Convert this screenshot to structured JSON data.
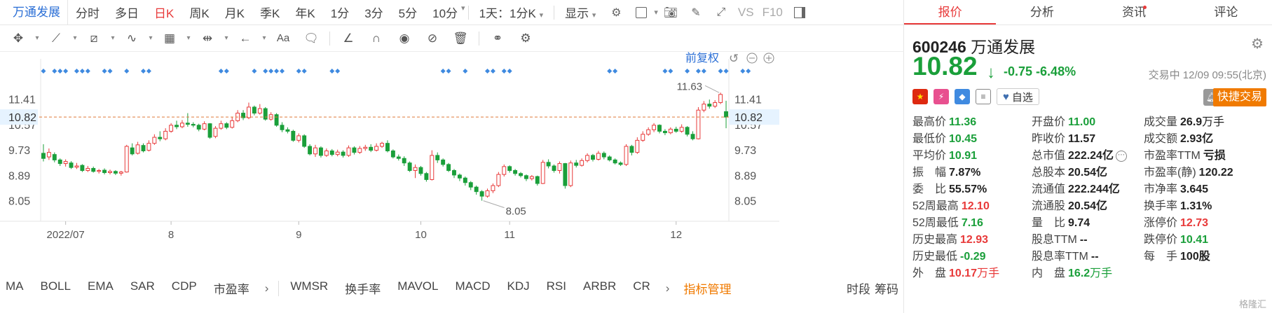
{
  "toolbar": {
    "stock_name": "万通发展",
    "periods": [
      "分时",
      "多日",
      "日K",
      "周K",
      "月K",
      "季K",
      "年K",
      "1分",
      "3分",
      "5分",
      "10分"
    ],
    "active_period": "日K",
    "range_select": "1天：1分K",
    "display_label": "显示",
    "vs_label": "VS",
    "f10_label": "F10"
  },
  "chart": {
    "adjust_label": "前复权",
    "high_marker": "11.63",
    "low_marker": "8.05",
    "current_price_tag": "10.82",
    "colors": {
      "up": "#e83a3a",
      "down": "#1a9f3a",
      "signal": "#3f8ae0",
      "price_line": "#e07b3a"
    }
  },
  "chart_data": {
    "type": "candlestick",
    "y_ticks": [
      "11.41",
      "10.57",
      "9.73",
      "8.89",
      "8.05"
    ],
    "x_ticks": [
      "2022/07",
      "8",
      "9",
      "10",
      "11",
      "12"
    ],
    "ylim": [
      7.6,
      12.1
    ],
    "current_price": 10.82,
    "candles": [
      [
        9.62,
        9.45,
        9.92,
        9.35
      ],
      [
        9.5,
        9.65,
        9.78,
        9.4
      ],
      [
        9.58,
        9.4,
        9.65,
        9.32
      ],
      [
        9.4,
        9.28,
        9.45,
        9.2
      ],
      [
        9.28,
        9.35,
        9.42,
        9.18
      ],
      [
        9.3,
        9.15,
        9.36,
        9.1
      ],
      [
        9.16,
        9.2,
        9.3,
        9.1
      ],
      [
        9.22,
        9.05,
        9.26,
        9.0
      ],
      [
        9.05,
        9.12,
        9.2,
        9.0
      ],
      [
        9.12,
        9.02,
        9.18,
        8.98
      ],
      [
        9.02,
        9.05,
        9.1,
        8.95
      ],
      [
        9.06,
        8.98,
        9.12,
        8.92
      ],
      [
        8.98,
        9.02,
        9.08,
        8.92
      ],
      [
        9.02,
        8.96,
        9.06,
        8.9
      ],
      [
        8.96,
        9.0,
        9.04,
        8.88
      ],
      [
        9.0,
        9.85,
        9.9,
        8.98
      ],
      [
        9.8,
        9.6,
        9.95,
        9.55
      ],
      [
        9.62,
        9.9,
        10.0,
        9.58
      ],
      [
        9.88,
        9.7,
        9.95,
        9.65
      ],
      [
        9.72,
        9.95,
        10.05,
        9.68
      ],
      [
        9.95,
        10.15,
        10.25,
        9.9
      ],
      [
        10.15,
        10.1,
        10.35,
        10.02
      ],
      [
        10.1,
        10.35,
        10.45,
        10.05
      ],
      [
        10.35,
        10.55,
        10.62,
        10.3
      ],
      [
        10.55,
        10.5,
        10.7,
        10.42
      ],
      [
        10.5,
        10.62,
        10.72,
        10.45
      ],
      [
        10.62,
        10.58,
        10.95,
        10.5
      ],
      [
        10.58,
        10.55,
        10.65,
        10.48
      ],
      [
        10.55,
        10.42,
        10.6,
        10.35
      ],
      [
        10.42,
        10.6,
        10.68,
        10.38
      ],
      [
        10.6,
        10.15,
        10.62,
        10.1
      ],
      [
        10.18,
        10.45,
        10.52,
        10.12
      ],
      [
        10.45,
        10.6,
        10.7,
        10.4
      ],
      [
        10.6,
        10.48,
        10.65,
        10.42
      ],
      [
        10.48,
        10.7,
        10.82,
        10.44
      ],
      [
        10.7,
        10.95,
        11.05,
        10.65
      ],
      [
        10.95,
        10.8,
        11.05,
        10.72
      ],
      [
        10.8,
        11.15,
        11.3,
        10.75
      ],
      [
        11.15,
        10.95,
        11.2,
        10.88
      ],
      [
        10.95,
        11.1,
        11.25,
        10.9
      ],
      [
        11.1,
        10.75,
        11.15,
        10.7
      ],
      [
        10.75,
        10.9,
        10.98,
        10.7
      ],
      [
        10.9,
        10.55,
        10.95,
        10.5
      ],
      [
        10.55,
        10.4,
        10.65,
        10.32
      ],
      [
        10.4,
        10.35,
        10.48,
        10.28
      ],
      [
        10.35,
        10.05,
        10.4,
        10.0
      ],
      [
        10.05,
        10.2,
        10.28,
        9.98
      ],
      [
        10.2,
        9.85,
        10.25,
        9.8
      ],
      [
        9.85,
        9.6,
        9.92,
        9.55
      ],
      [
        9.6,
        9.8,
        9.9,
        9.5
      ],
      [
        9.8,
        9.55,
        9.85,
        9.48
      ],
      [
        9.55,
        9.7,
        9.78,
        9.5
      ],
      [
        9.7,
        9.58,
        9.76,
        9.52
      ],
      [
        9.58,
        9.66,
        9.74,
        9.52
      ],
      [
        9.66,
        9.55,
        9.72,
        9.48
      ],
      [
        9.55,
        9.8,
        9.88,
        9.5
      ],
      [
        9.8,
        9.65,
        9.85,
        9.58
      ],
      [
        9.65,
        9.78,
        9.86,
        9.6
      ],
      [
        9.78,
        9.82,
        9.9,
        9.7
      ],
      [
        9.82,
        9.72,
        9.92,
        9.66
      ],
      [
        9.72,
        9.85,
        9.95,
        9.68
      ],
      [
        9.85,
        9.95,
        10.0,
        9.8
      ],
      [
        9.95,
        9.7,
        10.05,
        9.65
      ],
      [
        9.7,
        9.5,
        9.75,
        9.45
      ],
      [
        9.5,
        9.45,
        9.58,
        9.38
      ],
      [
        9.45,
        9.3,
        9.52,
        9.2
      ],
      [
        9.3,
        9.05,
        9.35,
        9.0
      ],
      [
        9.05,
        9.15,
        9.25,
        8.8
      ],
      [
        9.15,
        8.95,
        9.2,
        8.88
      ],
      [
        8.95,
        8.75,
        9.0,
        8.68
      ],
      [
        8.75,
        9.55,
        9.72,
        8.72
      ],
      [
        9.55,
        9.4,
        9.65,
        9.3
      ],
      [
        9.4,
        9.25,
        9.45,
        9.18
      ],
      [
        9.25,
        9.05,
        9.3,
        9.0
      ],
      [
        9.05,
        8.9,
        9.1,
        8.8
      ],
      [
        8.9,
        8.8,
        8.95,
        8.7
      ],
      [
        8.8,
        8.65,
        8.85,
        8.55
      ],
      [
        8.65,
        8.5,
        8.7,
        8.4
      ],
      [
        8.5,
        8.35,
        8.55,
        8.25
      ],
      [
        8.35,
        8.2,
        8.4,
        8.05
      ],
      [
        8.2,
        8.38,
        8.45,
        8.15
      ],
      [
        8.38,
        8.55,
        8.62,
        8.3
      ],
      [
        8.55,
        8.92,
        9.0,
        8.5
      ],
      [
        8.92,
        9.18,
        9.25,
        8.85
      ],
      [
        9.18,
        9.05,
        9.22,
        8.98
      ],
      [
        9.05,
        8.95,
        9.1,
        8.88
      ],
      [
        8.95,
        8.88,
        9.0,
        8.82
      ],
      [
        8.88,
        8.78,
        8.92,
        8.7
      ],
      [
        8.78,
        8.85,
        8.9,
        8.72
      ],
      [
        8.85,
        8.62,
        8.88,
        8.55
      ],
      [
        8.62,
        9.32,
        9.4,
        8.6
      ],
      [
        9.32,
        9.2,
        9.42,
        9.12
      ],
      [
        9.2,
        9.05,
        9.25,
        8.98
      ],
      [
        9.05,
        9.28,
        9.35,
        8.95
      ],
      [
        9.28,
        8.55,
        9.3,
        8.45
      ],
      [
        8.55,
        9.3,
        9.38,
        8.5
      ],
      [
        9.3,
        9.22,
        9.4,
        9.15
      ],
      [
        9.22,
        9.38,
        9.45,
        9.18
      ],
      [
        9.38,
        9.55,
        9.62,
        9.32
      ],
      [
        9.55,
        9.42,
        9.6,
        9.35
      ],
      [
        9.42,
        9.62,
        9.7,
        9.38
      ],
      [
        9.62,
        9.5,
        9.68,
        9.42
      ],
      [
        9.5,
        9.4,
        9.55,
        9.35
      ],
      [
        9.4,
        9.3,
        9.45,
        9.25
      ],
      [
        9.3,
        9.25,
        9.35,
        9.2
      ],
      [
        9.25,
        9.85,
        9.92,
        9.2
      ],
      [
        9.85,
        9.65,
        9.9,
        9.55
      ],
      [
        9.65,
        10.05,
        10.15,
        9.6
      ],
      [
        10.05,
        10.25,
        10.35,
        10.0
      ],
      [
        10.25,
        10.4,
        10.48,
        10.2
      ],
      [
        10.4,
        10.55,
        10.62,
        10.32
      ],
      [
        10.55,
        10.35,
        10.58,
        10.28
      ],
      [
        10.35,
        10.3,
        10.42,
        10.22
      ],
      [
        10.3,
        10.42,
        10.48,
        10.25
      ],
      [
        10.42,
        10.35,
        10.5,
        10.3
      ],
      [
        10.35,
        10.48,
        10.58,
        10.3
      ],
      [
        10.48,
        10.25,
        10.52,
        10.18
      ],
      [
        10.25,
        10.1,
        10.35,
        10.05
      ],
      [
        10.1,
        11.05,
        11.15,
        10.08
      ],
      [
        11.05,
        11.25,
        11.35,
        10.98
      ],
      [
        11.25,
        11.18,
        11.4,
        11.1
      ],
      [
        11.18,
        11.3,
        11.38,
        11.12
      ],
      [
        11.3,
        11.57,
        11.63,
        11.25
      ],
      [
        11.0,
        10.82,
        11.36,
        10.45
      ]
    ],
    "signal_markers": [
      0,
      2,
      3,
      4,
      6,
      7,
      8,
      11,
      12,
      15,
      18,
      19,
      32,
      33,
      38,
      40,
      41,
      42,
      43,
      46,
      47,
      52,
      53,
      72,
      73,
      76,
      80,
      81,
      83,
      84,
      102,
      103,
      112,
      113,
      116,
      118,
      119,
      122,
      123,
      126,
      127
    ]
  },
  "indicators": {
    "items": [
      "MA",
      "BOLL",
      "EMA",
      "SAR",
      "CDP",
      "市盈率"
    ],
    "items2": [
      "WMSR",
      "换手率",
      "MAVOL",
      "MACD",
      "KDJ",
      "RSI",
      "ARBR",
      "CR"
    ],
    "manage_label": "指标管理",
    "right_items": [
      "时段",
      "筹码"
    ]
  },
  "panel": {
    "tabs": [
      "报价",
      "分析",
      "资讯",
      "评论"
    ],
    "active_tab": "报价",
    "code": "600246",
    "name": "万通发展",
    "price": "10.82",
    "change": "-0.75",
    "change_pct": "-6.48%",
    "status_time": "交易中 12/09 09:55(北京)",
    "fav_label": "自选",
    "fast_trade_label": "快捷交易",
    "rows": [
      [
        {
          "l": "最高价",
          "v": "11.36",
          "c": "down"
        },
        {
          "l": "开盘价",
          "v": "11.00",
          "c": "down"
        },
        {
          "l": "成交量",
          "v": "26.9",
          "u": "万手",
          "c": "flat"
        }
      ],
      [
        {
          "l": "最低价",
          "v": "10.45",
          "c": "down"
        },
        {
          "l": "昨收价",
          "v": "11.57",
          "c": "flat"
        },
        {
          "l": "成交额",
          "v": "2.93亿",
          "c": "flat"
        }
      ],
      [
        {
          "l": "平均价",
          "v": "10.91",
          "c": "down"
        },
        {
          "l": "总市值",
          "v": "222.24亿",
          "c": "flat",
          "more": true
        },
        {
          "l": "市盈率TTM",
          "v": "亏损",
          "c": "flat"
        }
      ],
      [
        {
          "l": "振　幅",
          "v": "7.87%",
          "c": "flat"
        },
        {
          "l": "总股本",
          "v": "20.54亿",
          "c": "flat"
        },
        {
          "l": "市盈率(静)",
          "v": "120.22",
          "c": "flat"
        }
      ],
      [
        {
          "l": "委　比",
          "v": "55.57%",
          "c": "flat"
        },
        {
          "l": "流通值",
          "v": "222.244亿",
          "c": "flat"
        },
        {
          "l": "市净率",
          "v": "3.645",
          "c": "flat"
        }
      ],
      [
        {
          "l": "52周最高",
          "v": "12.10",
          "c": "up"
        },
        {
          "l": "流通股",
          "v": "20.54亿",
          "c": "flat"
        },
        {
          "l": "换手率",
          "v": "1.31%",
          "c": "flat"
        }
      ],
      [
        {
          "l": "52周最低",
          "v": "7.16",
          "c": "down"
        },
        {
          "l": "量　比",
          "v": "9.74",
          "c": "flat"
        },
        {
          "l": "涨停价",
          "v": "12.73",
          "c": "up"
        }
      ],
      [
        {
          "l": "历史最高",
          "v": "12.93",
          "c": "up"
        },
        {
          "l": "股息TTM",
          "v": "--",
          "c": "flat"
        },
        {
          "l": "跌停价",
          "v": "10.41",
          "c": "down"
        }
      ],
      [
        {
          "l": "历史最低",
          "v": "-0.29",
          "c": "down"
        },
        {
          "l": "股息率TTM",
          "v": "--",
          "c": "flat"
        },
        {
          "l": "每　手",
          "v": "100股",
          "c": "flat"
        }
      ],
      [
        {
          "l": "外　盘",
          "v": "10.17",
          "u": "万手",
          "c": "up"
        },
        {
          "l": "内　盘",
          "v": "16.2",
          "u": "万手",
          "c": "down"
        },
        {
          "l": "",
          "v": "",
          "c": "flat"
        }
      ]
    ],
    "watermark": "格隆汇"
  }
}
